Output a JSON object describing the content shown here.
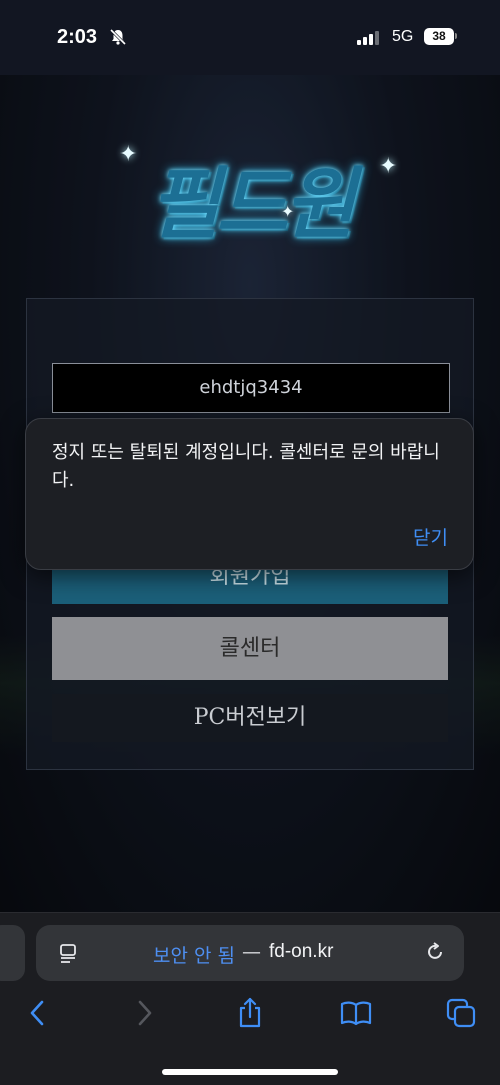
{
  "status": {
    "time": "2:03",
    "network": "5G",
    "battery": "38"
  },
  "logo": {
    "text": "필드원"
  },
  "login": {
    "id_value": "ehdtjq3434",
    "signup_label": "회원가입",
    "callcenter_label": "콜센터",
    "pc_version_label": "PC버전보기"
  },
  "alert": {
    "message": "정지 또는 탈퇴된 계정입니다. 콜센터로 문의 바랍니다.",
    "close_label": "닫기"
  },
  "browser": {
    "security_label": "보안 안 됨",
    "separator": "—",
    "domain": "fd-on.kr"
  },
  "icons": {
    "bell": "bell-slash-icon",
    "signal": "signal-icon",
    "page_menu": "page-menu-icon",
    "reload": "reload-icon",
    "back": "chevron-left-icon",
    "forward": "chevron-right-icon",
    "share": "share-icon",
    "bookmarks": "book-icon",
    "tabs": "tabs-icon"
  },
  "colors": {
    "accent": "#3f8ef5",
    "logo": "#2fb7e8",
    "signup": "#1b5f79"
  }
}
